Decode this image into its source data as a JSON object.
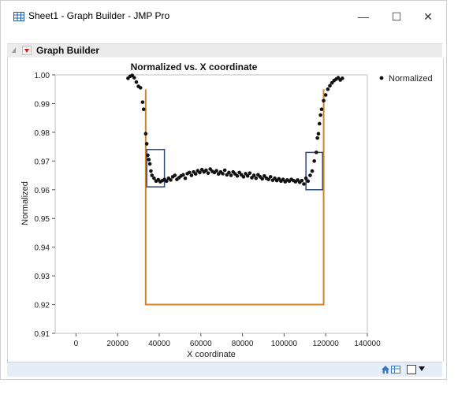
{
  "window": {
    "title": "Sheet1 - Graph Builder - JMP Pro",
    "minimize_glyph": "—",
    "maximize_glyph": "☐",
    "close_glyph": "✕"
  },
  "platform": {
    "title": "Graph Builder"
  },
  "icons": {
    "app": "datatable-icon",
    "collapse": "disclosure-triangle-icon",
    "menu": "red-triangle-menu-icon",
    "status": [
      "home-icon",
      "grid-icon",
      "box-icon",
      "dropdown-arrow-icon"
    ]
  },
  "colors": {
    "points": "#111111",
    "trough": "#d4822b",
    "highlight_box": "#2e4a7a",
    "status_bar": "#e4edf8"
  },
  "chart_data": {
    "type": "scatter",
    "title": "Normalized vs. X coordinate",
    "xlabel": "X coordinate",
    "ylabel": "Normalized",
    "legend": [
      "Normalized"
    ],
    "legend_position": "top-right",
    "xlim": [
      -10000,
      140000
    ],
    "ylim": [
      0.91,
      1.0
    ],
    "x_ticks": [
      0,
      20000,
      40000,
      60000,
      80000,
      100000,
      120000,
      140000
    ],
    "y_ticks": [
      0.91,
      0.92,
      0.93,
      0.94,
      0.95,
      0.96,
      0.97,
      0.98,
      0.99,
      1.0
    ],
    "x_tick_labels": [
      "0",
      "20000",
      "40000",
      "60000",
      "80000",
      "100000",
      "120000",
      "140000"
    ],
    "y_tick_labels": [
      "0.91",
      "0.92",
      "0.93",
      "0.94",
      "0.95",
      "0.96",
      "0.97",
      "0.98",
      "0.99",
      "1.00"
    ],
    "series": [
      {
        "name": "Normalized",
        "points": [
          [
            25000,
            0.9988
          ],
          [
            26000,
            0.9995
          ],
          [
            27000,
            0.9998
          ],
          [
            28000,
            0.999
          ],
          [
            29000,
            0.9975
          ],
          [
            30000,
            0.996
          ],
          [
            31000,
            0.9955
          ],
          [
            32000,
            0.9905
          ],
          [
            32500,
            0.988
          ],
          [
            33500,
            0.9795
          ],
          [
            34000,
            0.976
          ],
          [
            34500,
            0.972
          ],
          [
            35000,
            0.9705
          ],
          [
            35500,
            0.969
          ],
          [
            36000,
            0.9665
          ],
          [
            36500,
            0.965
          ],
          [
            37500,
            0.964
          ],
          [
            38500,
            0.963
          ],
          [
            39500,
            0.9635
          ],
          [
            40500,
            0.9628
          ],
          [
            41500,
            0.9632
          ],
          [
            42500,
            0.9636
          ],
          [
            43500,
            0.963
          ],
          [
            44500,
            0.964
          ],
          [
            45500,
            0.9634
          ],
          [
            46500,
            0.9645
          ],
          [
            47500,
            0.965
          ],
          [
            48500,
            0.9636
          ],
          [
            49500,
            0.9642
          ],
          [
            50500,
            0.9648
          ],
          [
            51500,
            0.9652
          ],
          [
            52500,
            0.964
          ],
          [
            53500,
            0.9656
          ],
          [
            54500,
            0.966
          ],
          [
            55500,
            0.965
          ],
          [
            56500,
            0.9662
          ],
          [
            57500,
            0.9655
          ],
          [
            58500,
            0.9666
          ],
          [
            59500,
            0.966
          ],
          [
            60500,
            0.967
          ],
          [
            61500,
            0.9662
          ],
          [
            62500,
            0.9668
          ],
          [
            63500,
            0.9658
          ],
          [
            64500,
            0.9672
          ],
          [
            65500,
            0.9664
          ],
          [
            66500,
            0.966
          ],
          [
            67500,
            0.9666
          ],
          [
            68500,
            0.9655
          ],
          [
            69500,
            0.9662
          ],
          [
            70500,
            0.9656
          ],
          [
            71500,
            0.9668
          ],
          [
            72500,
            0.9652
          ],
          [
            73500,
            0.966
          ],
          [
            74500,
            0.965
          ],
          [
            75500,
            0.9662
          ],
          [
            76500,
            0.9655
          ],
          [
            77500,
            0.9648
          ],
          [
            78500,
            0.966
          ],
          [
            79500,
            0.9652
          ],
          [
            80500,
            0.9645
          ],
          [
            81500,
            0.9656
          ],
          [
            82500,
            0.9648
          ],
          [
            83500,
            0.9658
          ],
          [
            84500,
            0.9642
          ],
          [
            85500,
            0.965
          ],
          [
            86500,
            0.964
          ],
          [
            87500,
            0.9652
          ],
          [
            88500,
            0.9645
          ],
          [
            89500,
            0.9638
          ],
          [
            90500,
            0.9648
          ],
          [
            91500,
            0.964
          ],
          [
            92500,
            0.9636
          ],
          [
            93500,
            0.9645
          ],
          [
            94500,
            0.9633
          ],
          [
            95500,
            0.964
          ],
          [
            96500,
            0.9632
          ],
          [
            97500,
            0.9638
          ],
          [
            98500,
            0.963
          ],
          [
            99500,
            0.9636
          ],
          [
            100500,
            0.9628
          ],
          [
            101500,
            0.9634
          ],
          [
            102500,
            0.963
          ],
          [
            103500,
            0.9636
          ],
          [
            104500,
            0.9632
          ],
          [
            105500,
            0.9628
          ],
          [
            106500,
            0.9634
          ],
          [
            107500,
            0.9626
          ],
          [
            108500,
            0.9632
          ],
          [
            109500,
            0.962
          ],
          [
            110500,
            0.964
          ],
          [
            111500,
            0.963
          ],
          [
            112500,
            0.965
          ],
          [
            113500,
            0.9665
          ],
          [
            114500,
            0.97
          ],
          [
            115500,
            0.973
          ],
          [
            116000,
            0.978
          ],
          [
            116500,
            0.9795
          ],
          [
            117000,
            0.983
          ],
          [
            117500,
            0.986
          ],
          [
            118000,
            0.988
          ],
          [
            119000,
            0.991
          ],
          [
            120000,
            0.993
          ],
          [
            121000,
            0.995
          ],
          [
            122000,
            0.9962
          ],
          [
            123000,
            0.9972
          ],
          [
            124000,
            0.998
          ],
          [
            125000,
            0.9985
          ],
          [
            126000,
            0.999
          ],
          [
            127000,
            0.9982
          ],
          [
            128000,
            0.9988
          ]
        ]
      }
    ],
    "trough_outline": [
      [
        33500,
        0.995
      ],
      [
        33500,
        0.92
      ],
      [
        119000,
        0.92
      ],
      [
        119000,
        0.995
      ]
    ],
    "highlight_boxes": [
      {
        "x0": 34000,
        "x1": 42500,
        "y0": 0.961,
        "y1": 0.974
      },
      {
        "x0": 110500,
        "x1": 118500,
        "y0": 0.96,
        "y1": 0.973
      }
    ]
  }
}
